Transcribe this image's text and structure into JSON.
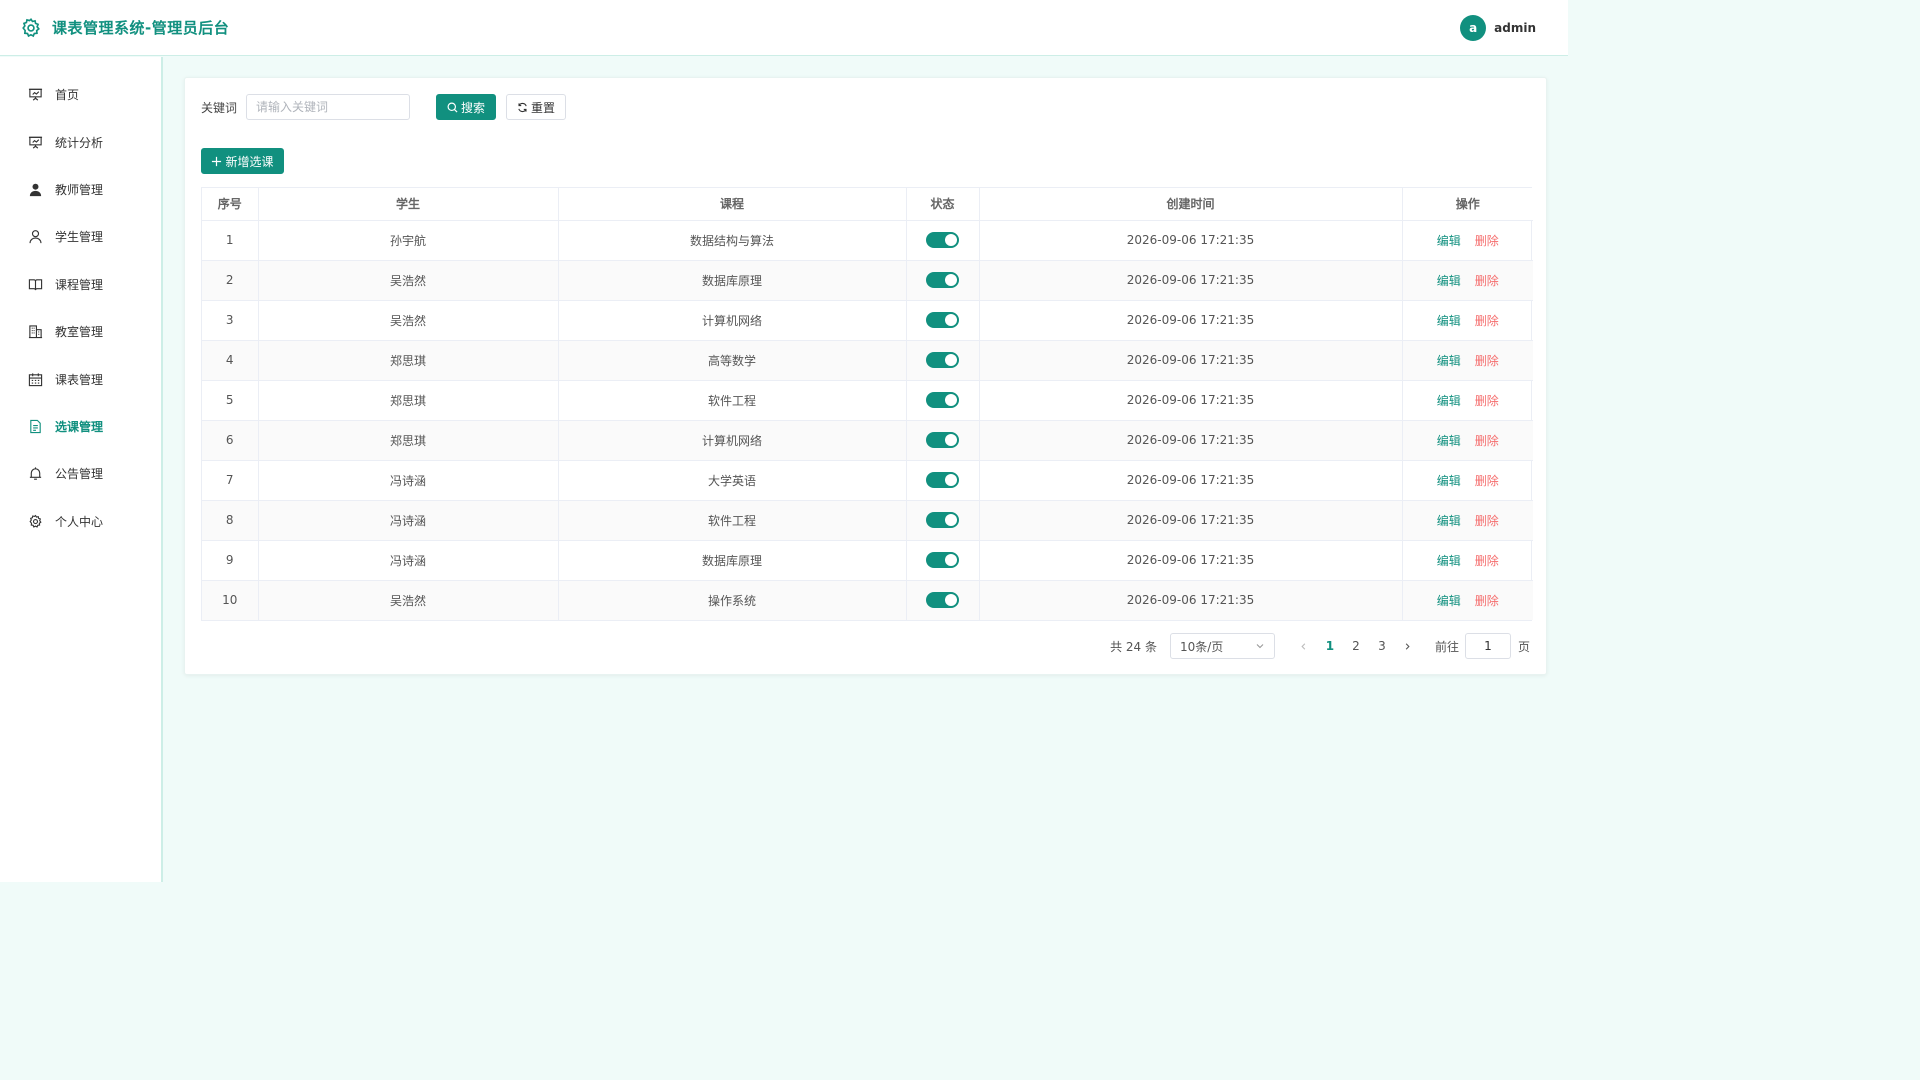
{
  "header": {
    "title": "课表管理系统-管理员后台",
    "avatar_letter": "a",
    "username": "admin"
  },
  "sidebar": {
    "items": [
      {
        "label": "首页",
        "icon": "presentation-icon"
      },
      {
        "label": "统计分析",
        "icon": "chart-board-icon"
      },
      {
        "label": "教师管理",
        "icon": "user-filled-icon"
      },
      {
        "label": "学生管理",
        "icon": "user-icon"
      },
      {
        "label": "课程管理",
        "icon": "book-icon"
      },
      {
        "label": "教室管理",
        "icon": "building-icon"
      },
      {
        "label": "课表管理",
        "icon": "calendar-icon"
      },
      {
        "label": "选课管理",
        "icon": "document-icon",
        "active": true
      },
      {
        "label": "公告管理",
        "icon": "bell-icon"
      },
      {
        "label": "个人中心",
        "icon": "gear-icon"
      }
    ]
  },
  "search": {
    "label": "关键词",
    "placeholder": "请输入关键词",
    "value": "",
    "search_label": "搜索",
    "reset_label": "重置"
  },
  "toolbar": {
    "add_label": "新增选课"
  },
  "table": {
    "columns": [
      "序号",
      "学生",
      "课程",
      "状态",
      "创建时间",
      "操作"
    ],
    "edit_label": "编辑",
    "delete_label": "删除",
    "rows": [
      {
        "index": "1",
        "student": "孙宇航",
        "course": "数据结构与算法",
        "status": true,
        "created": "2026-09-06 17:21:35"
      },
      {
        "index": "2",
        "student": "吴浩然",
        "course": "数据库原理",
        "status": true,
        "created": "2026-09-06 17:21:35"
      },
      {
        "index": "3",
        "student": "吴浩然",
        "course": "计算机网络",
        "status": true,
        "created": "2026-09-06 17:21:35"
      },
      {
        "index": "4",
        "student": "郑思琪",
        "course": "高等数学",
        "status": true,
        "created": "2026-09-06 17:21:35"
      },
      {
        "index": "5",
        "student": "郑思琪",
        "course": "软件工程",
        "status": true,
        "created": "2026-09-06 17:21:35"
      },
      {
        "index": "6",
        "student": "郑思琪",
        "course": "计算机网络",
        "status": true,
        "created": "2026-09-06 17:21:35"
      },
      {
        "index": "7",
        "student": "冯诗涵",
        "course": "大学英语",
        "status": true,
        "created": "2026-09-06 17:21:35"
      },
      {
        "index": "8",
        "student": "冯诗涵",
        "course": "软件工程",
        "status": true,
        "created": "2026-09-06 17:21:35"
      },
      {
        "index": "9",
        "student": "冯诗涵",
        "course": "数据库原理",
        "status": true,
        "created": "2026-09-06 17:21:35"
      },
      {
        "index": "10",
        "student": "吴浩然",
        "course": "操作系统",
        "status": true,
        "created": "2026-09-06 17:21:35"
      }
    ]
  },
  "pagination": {
    "total_text": "共 24 条",
    "page_size": "10条/页",
    "pages": [
      "1",
      "2",
      "3"
    ],
    "current_page": "1",
    "jump_label": "前往",
    "jump_value": "1",
    "jump_unit": "页"
  },
  "colors": {
    "primary": "#11907f",
    "danger": "#f56c6c",
    "background": "#f0fbf9"
  }
}
